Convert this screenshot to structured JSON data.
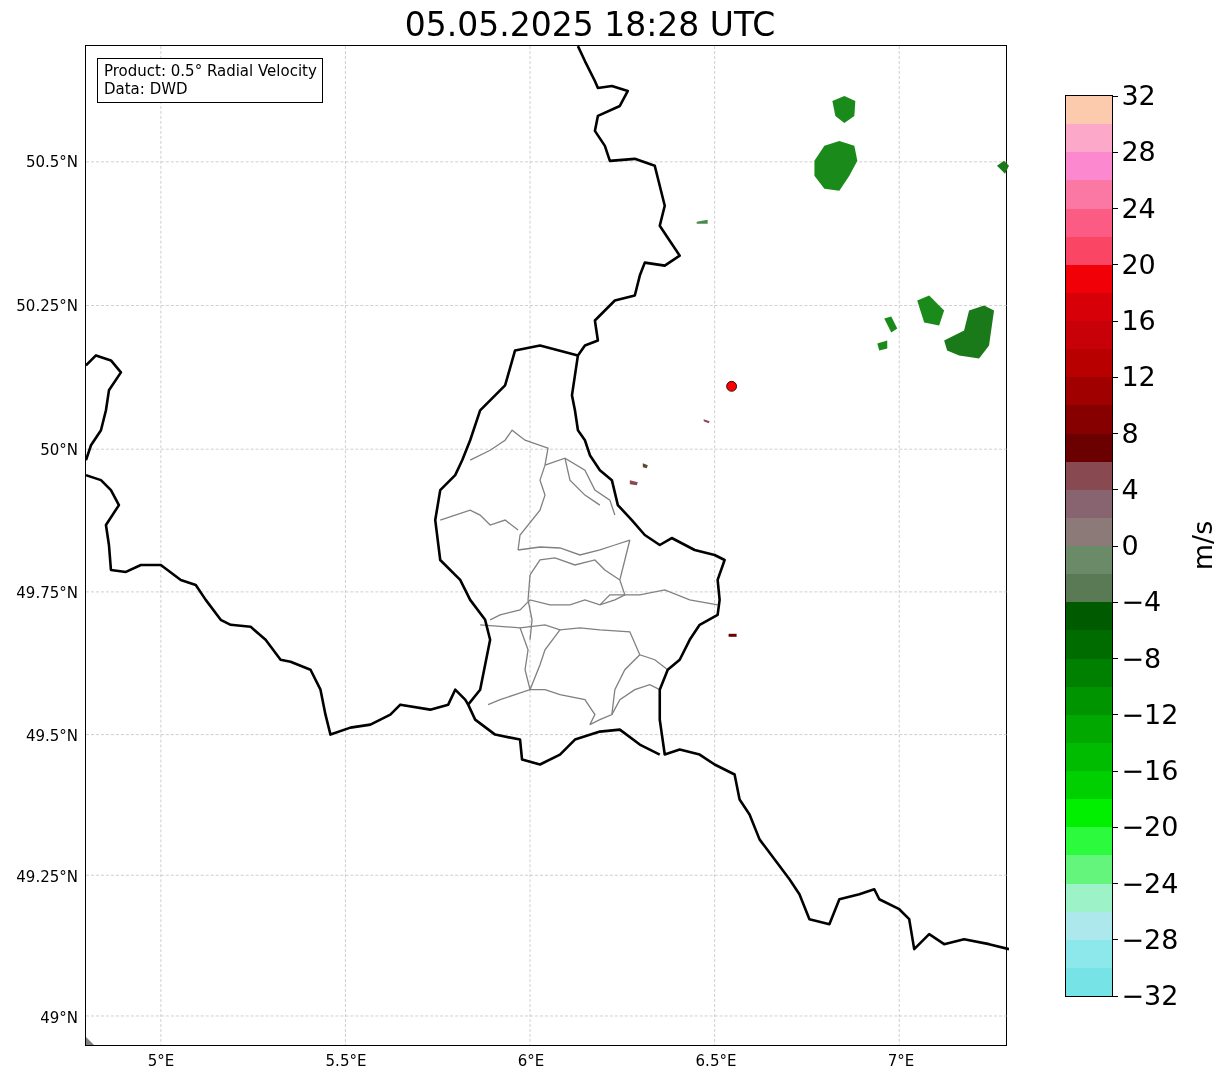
{
  "title": "05.05.2025 18:28 UTC",
  "info_box": {
    "lines": [
      "Product: 0.5° Radial Velocity",
      "Data: DWD"
    ]
  },
  "axes": {
    "x_tick_labels": [
      "5°E",
      "5.5°E",
      "6°E",
      "6.5°E",
      "7°E"
    ],
    "y_tick_labels": [
      "50.5°N",
      "50.25°N",
      "50°N",
      "49.75°N",
      "49.5°N",
      "49.25°N",
      "49°N"
    ]
  },
  "colorbar": {
    "label": "m/s",
    "tick_labels": [
      "32",
      "28",
      "24",
      "20",
      "16",
      "12",
      "8",
      "4",
      "0",
      "−4",
      "−8",
      "−12",
      "−16",
      "−20",
      "−24",
      "−28",
      "−32"
    ],
    "bins": [
      {
        "color": "#fccaac"
      },
      {
        "color": "#fca8c8"
      },
      {
        "color": "#fc88d0"
      },
      {
        "color": "#fc78a4"
      },
      {
        "color": "#fc5c84"
      },
      {
        "color": "#fa4664"
      },
      {
        "color": "#f20008"
      },
      {
        "color": "#d80008"
      },
      {
        "color": "#c80008"
      },
      {
        "color": "#b80000"
      },
      {
        "color": "#a00000"
      },
      {
        "color": "#860000"
      },
      {
        "color": "#6a0000"
      },
      {
        "color": "#884a50"
      },
      {
        "color": "#886470"
      },
      {
        "color": "#8c7a78"
      },
      {
        "color": "#6a8a68"
      },
      {
        "color": "#5a7a56"
      },
      {
        "color": "#005a00"
      },
      {
        "color": "#006c00"
      },
      {
        "color": "#008000"
      },
      {
        "color": "#009400"
      },
      {
        "color": "#00a800"
      },
      {
        "color": "#00bc00"
      },
      {
        "color": "#00d000"
      },
      {
        "color": "#00f000"
      },
      {
        "color": "#2cfa3c"
      },
      {
        "color": "#64f67c"
      },
      {
        "color": "#9ef2c8"
      },
      {
        "color": "#ace8ec"
      },
      {
        "color": "#8ce8ea"
      },
      {
        "color": "#76e4e6"
      }
    ]
  }
}
